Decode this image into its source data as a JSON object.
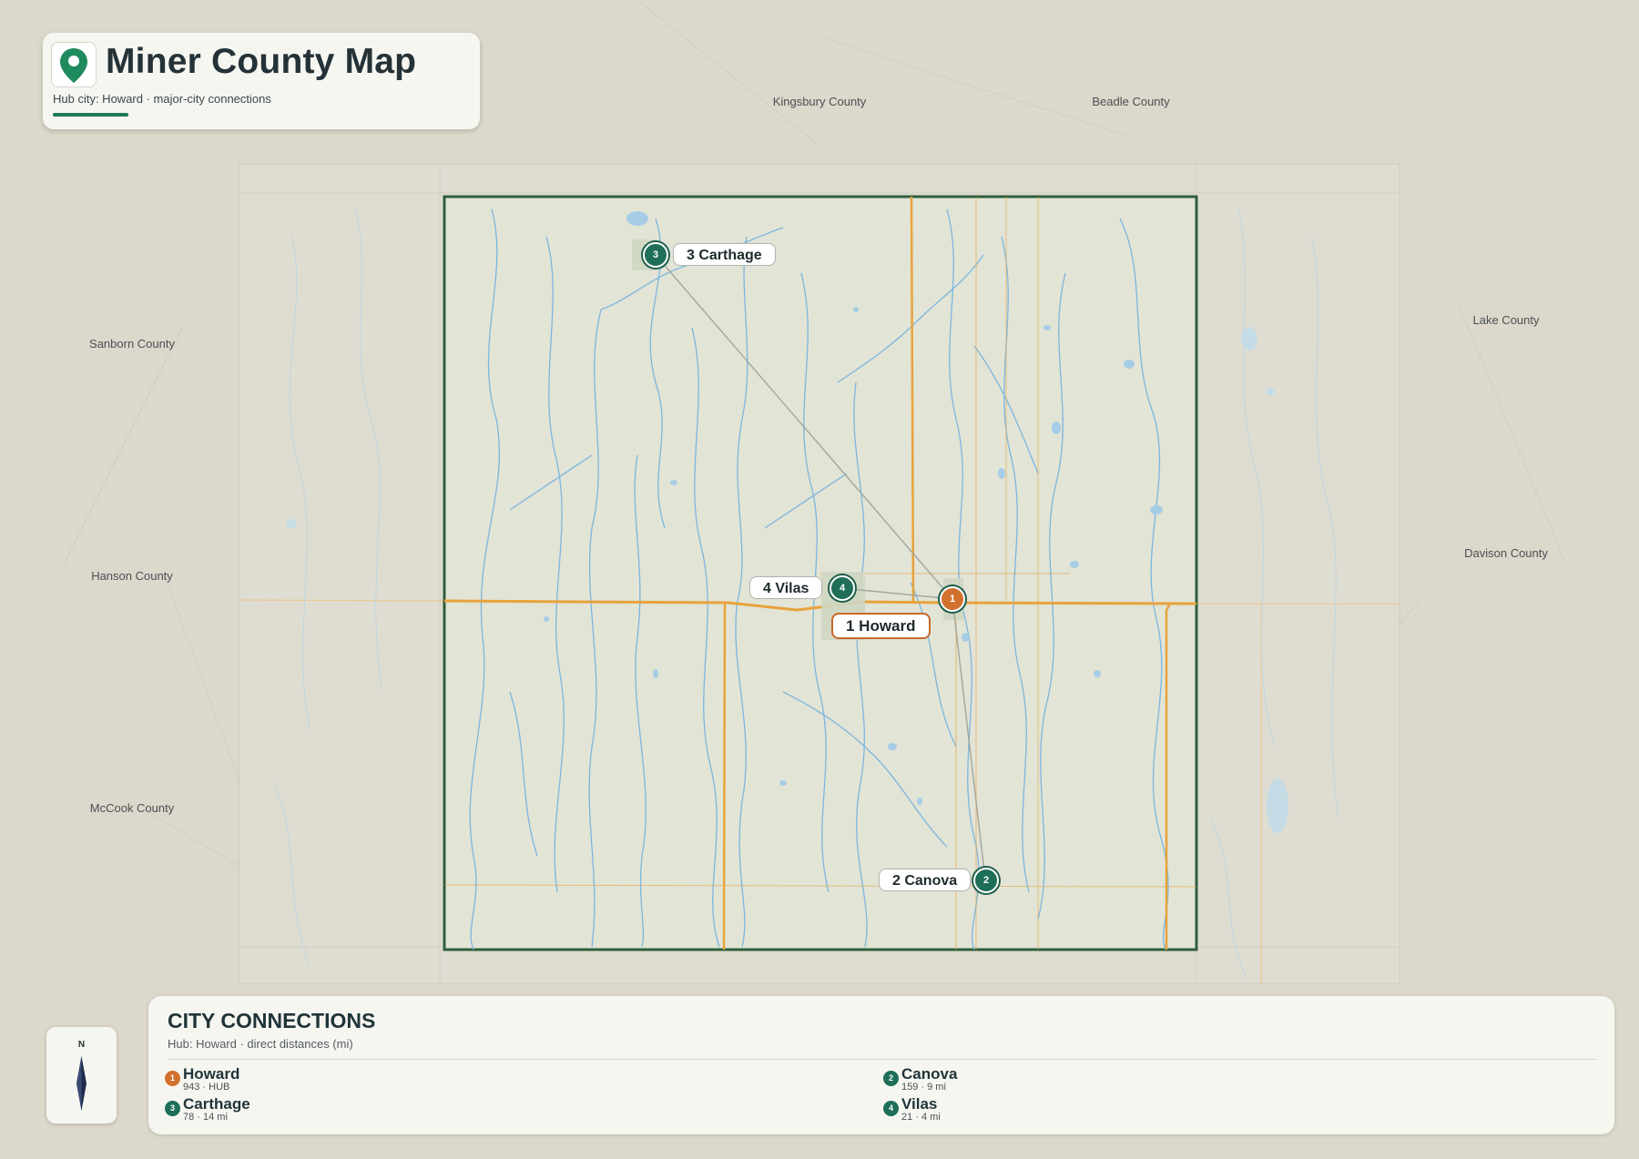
{
  "header": {
    "title": "Miner County Map",
    "subtitle": "Hub city: Howard · major-city connections",
    "icon": "map-pin-icon"
  },
  "counties": [
    {
      "name": "Kingsbury County"
    },
    {
      "name": "Beadle County"
    },
    {
      "name": "Sanborn County"
    },
    {
      "name": "Hanson County"
    },
    {
      "name": "McCook County"
    },
    {
      "name": "Lake County"
    },
    {
      "name": "Davison County"
    }
  ],
  "cities": [
    {
      "id": "1",
      "name": "Howard",
      "label": "1 Howard",
      "hub": true
    },
    {
      "id": "2",
      "name": "Canova",
      "label": "2 Canova",
      "hub": false
    },
    {
      "id": "3",
      "name": "Carthage",
      "label": "3 Carthage",
      "hub": false
    },
    {
      "id": "4",
      "name": "Vilas",
      "label": "4 Vilas",
      "hub": false
    }
  ],
  "compass": {
    "label": "N",
    "icon": "north-arrow-icon"
  },
  "legend": {
    "title": "CITY CONNECTIONS",
    "subtitle": "Hub: Howard · direct distances (mi)",
    "items": [
      {
        "num": "1",
        "name": "Howard",
        "meta": "943 · HUB"
      },
      {
        "num": "2",
        "name": "Canova",
        "meta": "159 · 9 mi"
      },
      {
        "num": "3",
        "name": "Carthage",
        "meta": "78 · 14 mi"
      },
      {
        "num": "4",
        "name": "Vilas",
        "meta": "21 · 4 mi"
      }
    ]
  },
  "colors": {
    "hub": "#d2702e",
    "city": "#1e6e58",
    "road": "#e8a33c",
    "border": "#2f5e3a",
    "water": "#6aaedb",
    "accent": "#1f7a58"
  }
}
